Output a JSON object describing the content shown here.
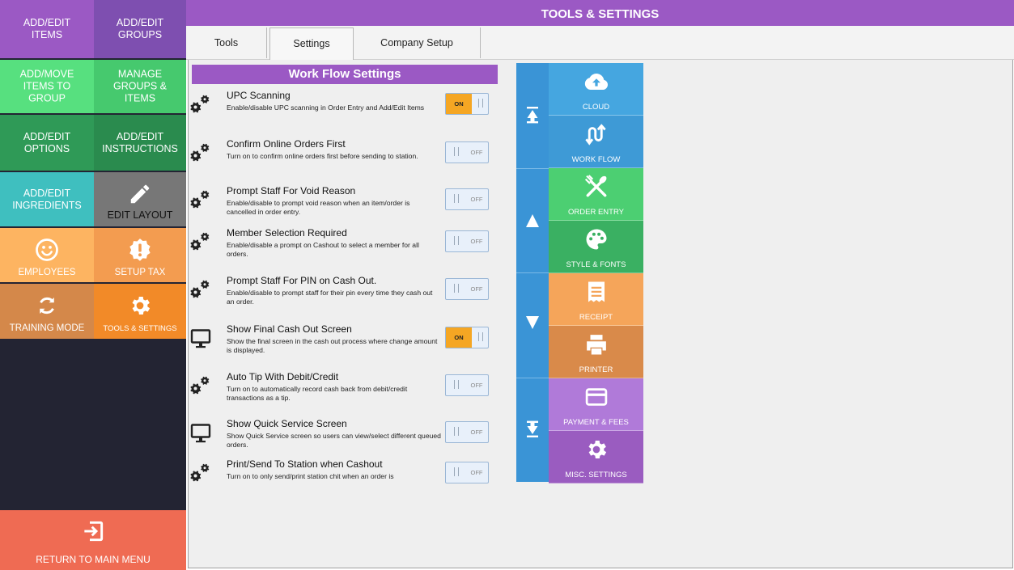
{
  "header": {
    "title": "TOOLS & SETTINGS"
  },
  "sidebar": {
    "tiles": [
      {
        "label": "ADD/EDIT\nITEMS",
        "color": "#9b59c4"
      },
      {
        "label": "ADD/EDIT\nGROUPS",
        "color": "#7e4fb0"
      },
      {
        "label": "ADD/MOVE\nITEMS TO\nGROUP",
        "color": "#57e07f"
      },
      {
        "label": "MANAGE\nGROUPS &\nITEMS",
        "color": "#46c96e"
      },
      {
        "label": "ADD/EDIT\nOPTIONS",
        "color": "#2f9a57"
      },
      {
        "label": "ADD/EDIT\nINSTRUCTIONS",
        "color": "#2a8b4e"
      },
      {
        "label": "ADD/EDIT\nINGREDIENTS",
        "color": "#3fbfbf"
      },
      {
        "label": "EDIT LAYOUT",
        "icon": "pencil-icon",
        "color": "#777777"
      },
      {
        "label": "EMPLOYEES",
        "icon": "smiley-icon",
        "color": "#fdb461"
      },
      {
        "label": "SETUP TAX",
        "icon": "alert-badge-icon",
        "color": "#f39c50"
      },
      {
        "label": "TRAINING MODE",
        "icon": "sync-icon",
        "color": "#d4884a"
      },
      {
        "label": "TOOLS & SETTINGS",
        "icon": "gear-icon",
        "color": "#f28a28"
      }
    ],
    "return_label": "RETURN TO MAIN MENU",
    "return_icon": "exit-icon"
  },
  "tabs": [
    {
      "label": "Tools"
    },
    {
      "label": "Settings",
      "active": true
    },
    {
      "label": "Company Setup"
    }
  ],
  "workflow": {
    "title": "Work Flow Settings",
    "settings": [
      {
        "title": "UPC Scanning",
        "desc": "Enable/disable UPC scanning in Order Entry and Add/Edit Items",
        "state": "ON",
        "icon": "gears-icon"
      },
      {
        "title": "Confirm Online Orders First",
        "desc": "Turn on to confirm online orders first before sending to station.",
        "state": "OFF",
        "icon": "gears-icon"
      },
      {
        "title": "Prompt Staff For Void Reason",
        "desc": "Enable/disable to prompt void reason when an item/order is cancelled in order entry.",
        "state": "OFF",
        "icon": "gears-icon"
      },
      {
        "title": "Member Selection Required",
        "desc": "Enable/disable a prompt on Cashout to select a member for all orders.",
        "state": "OFF",
        "icon": "gears-icon"
      },
      {
        "title": "Prompt Staff For PIN on Cash Out.",
        "desc": "Enable/disable to prompt staff for their pin every time they cash out an order.",
        "state": "OFF",
        "icon": "gears-icon"
      },
      {
        "title": "Show Final Cash Out Screen",
        "desc": "Show the final screen in the cash out process where change amount is displayed.",
        "state": "ON",
        "icon": "monitor-icon"
      },
      {
        "title": "Auto Tip With Debit/Credit",
        "desc": "Turn on to automatically record cash back from debit/credit transactions as a tip.",
        "state": "OFF",
        "icon": "gears-icon"
      },
      {
        "title": "Show Quick Service Screen",
        "desc": "Show Quick Service screen so users can view/select different queued orders.",
        "state": "OFF",
        "icon": "monitor-icon"
      },
      {
        "title": "Print/Send To Station when Cashout",
        "desc": "Turn on to only send/print station chit when an order is",
        "state": "OFF",
        "icon": "gears-icon"
      }
    ]
  },
  "categories": [
    {
      "label": "CLOUD",
      "icon": "cloud-upload-icon",
      "color": "#45a6e0"
    },
    {
      "label": "WORK FLOW",
      "icon": "workflow-icon",
      "color": "#3e9ad6"
    },
    {
      "label": "ORDER ENTRY",
      "icon": "utensils-icon",
      "color": "#4ccf72"
    },
    {
      "label": "STYLE & FONTS",
      "icon": "palette-icon",
      "color": "#3ab062"
    },
    {
      "label": "RECEIPT",
      "icon": "receipt-icon",
      "color": "#f5a55a"
    },
    {
      "label": "PRINTER",
      "icon": "printer-icon",
      "color": "#d98a4a"
    },
    {
      "label": "PAYMENT & FEES",
      "icon": "credit-card-icon",
      "color": "#b07ad9"
    },
    {
      "label": "MISC. SETTINGS",
      "icon": "gear-icon",
      "color": "#9a5cc0"
    }
  ],
  "scroll": {
    "buttons": [
      {
        "name": "scroll-top-button",
        "icon": "arrow-top-icon"
      },
      {
        "name": "scroll-up-button",
        "icon": "arrow-up-icon"
      },
      {
        "name": "scroll-down-button",
        "icon": "arrow-down-icon"
      },
      {
        "name": "scroll-bottom-button",
        "icon": "arrow-bottom-icon"
      }
    ]
  }
}
